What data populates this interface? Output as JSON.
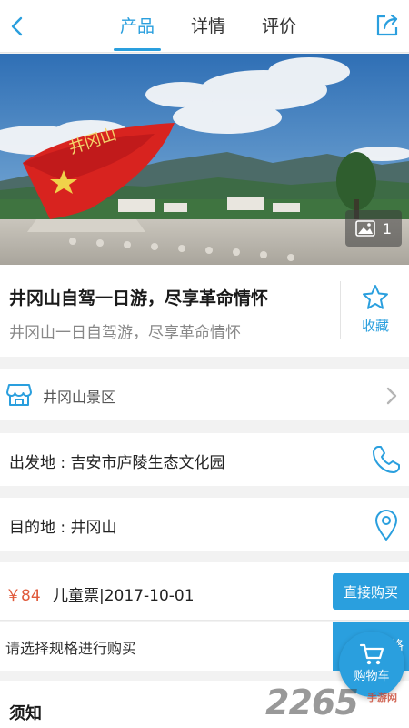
{
  "header": {
    "tabs": [
      {
        "label": "产品",
        "active": true
      },
      {
        "label": "详情",
        "active": false
      },
      {
        "label": "评价",
        "active": false
      }
    ],
    "back_icon": "chevron-left-icon",
    "share_icon": "share-icon"
  },
  "hero": {
    "sculpture_text": "井冈山",
    "gallery_count": "1",
    "gallery_icon": "image-icon"
  },
  "product": {
    "title": "井冈山自驾一日游，尽享革命情怀",
    "subtitle": "井冈山一日自驾游，尽享革命情怀",
    "favorite_label": "收藏"
  },
  "scenic": {
    "label": "井冈山景区"
  },
  "departure": {
    "text": "出发地 : 吉安市庐陵生态文化园"
  },
  "destination": {
    "text": "目的地 : 井冈山"
  },
  "ticket": {
    "price": "￥84",
    "name": "儿童票|2017-10-01",
    "buy_label": "直接购买"
  },
  "spec": {
    "prompt": "请选择规格进行购买",
    "button_partial": "格"
  },
  "notice": {
    "title": "须知"
  },
  "cart": {
    "label": "购物车"
  },
  "watermark": {
    "number": "2265",
    "suffix": "手游网"
  },
  "colors": {
    "accent": "#2a9fde",
    "price": "#e05a3b",
    "background": "#f2f2f2"
  }
}
